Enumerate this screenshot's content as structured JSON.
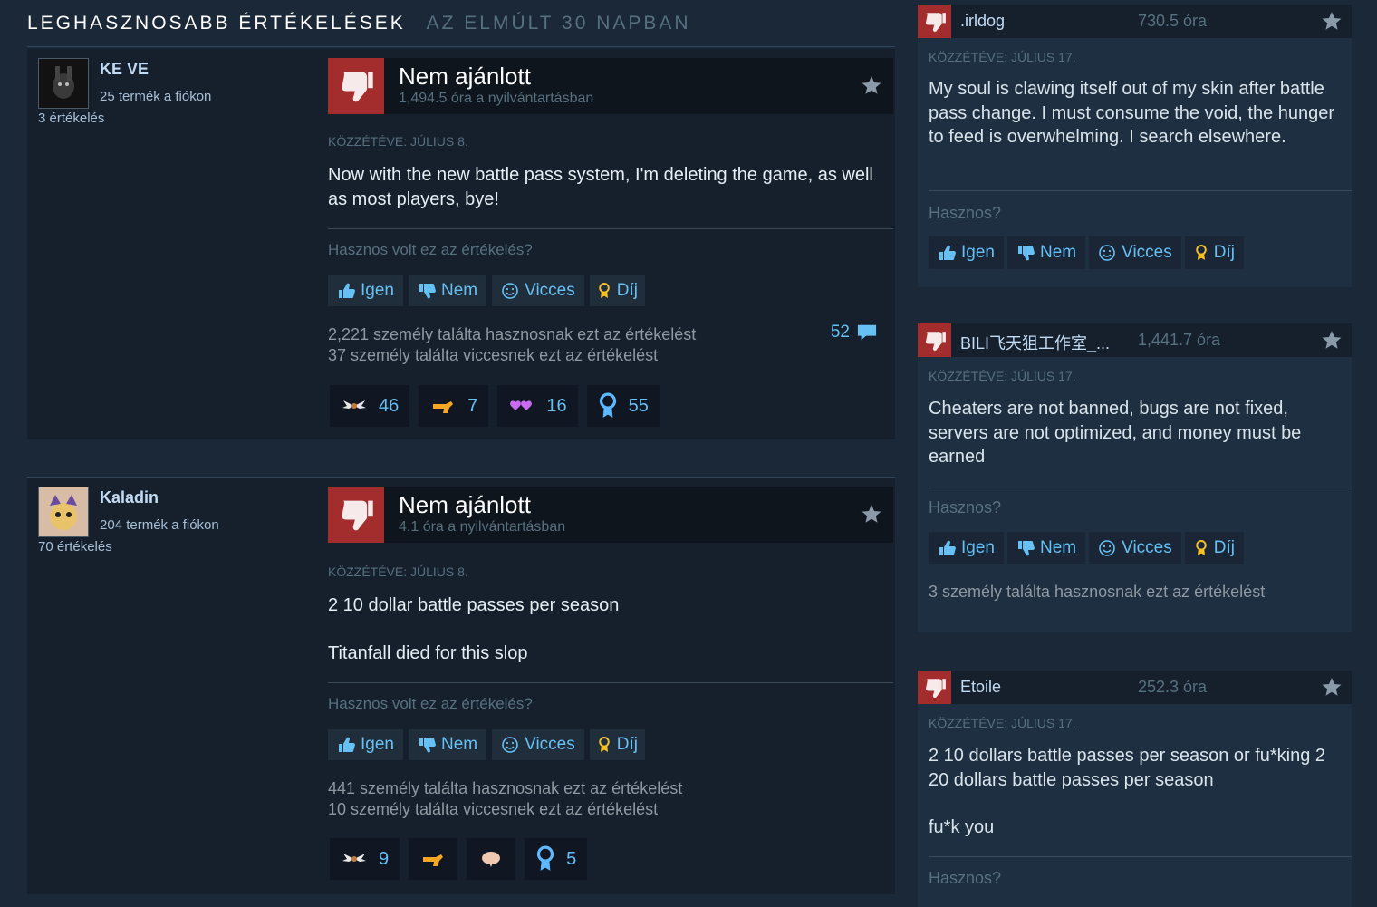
{
  "section": {
    "title": "LEGHASZNOSABB ÉRTÉKELÉSEK",
    "subtitle": "AZ ELMÚLT 30 NAPBAN"
  },
  "buttons": {
    "yes": "Igen",
    "no": "Nem",
    "funny": "Vicces",
    "award": "Díj"
  },
  "left_reviews": [
    {
      "author": {
        "name": "KE VE",
        "products": "25 termék a fiókon",
        "reviews": "3 értékelés"
      },
      "verdict": "Nem ajánlott",
      "hours": "1,494.5 óra a nyilvántartásban",
      "posted": "KÖZZÉTÉVE: JÚLIUS 8.",
      "text": "Now with the new battle pass system, I'm deleting the game, as well as most players, bye!",
      "helpful_question": "Hasznos volt ez az értékelés?",
      "helpful_stat": "2,221 személy találta hasznosnak ezt az értékelést",
      "funny_stat": "37 személy találta viccesnek ezt az értékelést",
      "comment_count": "52",
      "awards": [
        "46",
        "7",
        "16",
        "55"
      ]
    },
    {
      "author": {
        "name": "Kaladin",
        "products": "204 termék a fiókon",
        "reviews": "70 értékelés"
      },
      "verdict": "Nem ajánlott",
      "hours": "4.1 óra a nyilvántartásban",
      "posted": "KÖZZÉTÉVE: JÚLIUS 8.",
      "text_line1": "2 10 dollar battle passes per season",
      "text_line2": "Titanfall died for this slop",
      "helpful_question": "Hasznos volt ez az értékelés?",
      "helpful_stat": "441 személy találta hasznosnak ezt az értékelést",
      "funny_stat": "10 személy találta viccesnek ezt az értékelést",
      "awards": [
        "9",
        "",
        "",
        "5"
      ]
    }
  ],
  "right_reviews": [
    {
      "name": ".irldog",
      "hours": "730.5 óra",
      "posted": "KÖZZÉTÉVE: JÚLIUS 17.",
      "text": "My soul is clawing itself out of my skin after battle pass change. I must consume the void, the hunger to feed is overwhelming. I search elsewhere.",
      "helpful_question": "Hasznos?"
    },
    {
      "name": "BILI飞天狙工作室_...",
      "hours": "1,441.7 óra",
      "posted": "KÖZZÉTÉVE: JÚLIUS 17.",
      "text": "Cheaters are not banned, bugs are not fixed, servers are not optimized, and money must be earned",
      "helpful_question": "Hasznos?",
      "helpful_stat": "3 személy találta hasznosnak ezt az értékelést"
    },
    {
      "name": "Etoile",
      "hours": "252.3 óra",
      "posted": "KÖZZÉTÉVE: JÚLIUS 17.",
      "text_line1": "2 10 dollars battle passes per season or fu*king 2 20 dollars battle passes per season",
      "text_line2": "fu*k you",
      "helpful_question": "Hasznos?"
    }
  ],
  "colors": {
    "background": "#1b2838",
    "thumb_down": "#a22d2c",
    "link_blue": "#66c0f4"
  }
}
